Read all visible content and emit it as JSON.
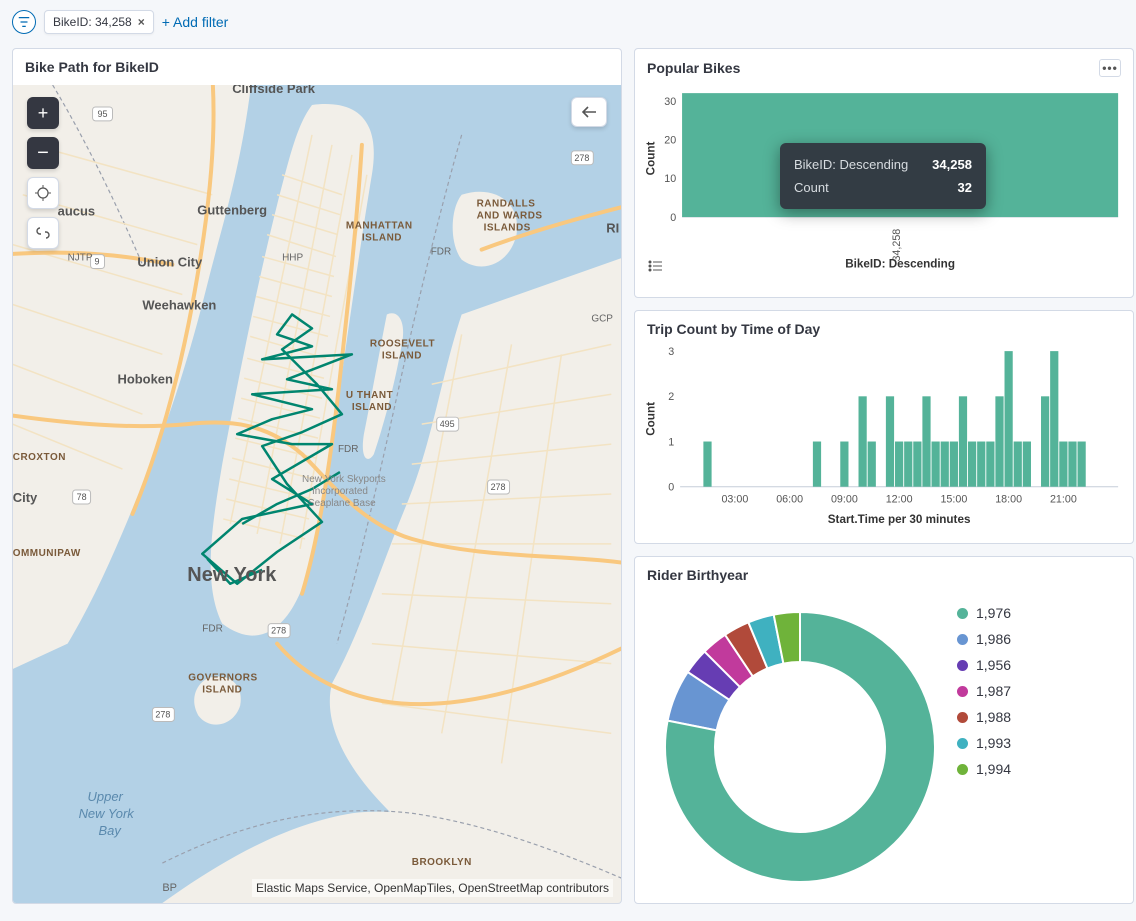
{
  "filter_bar": {
    "filter_pill_label": "BikeID: 34,258",
    "add_filter_label": "+ Add filter"
  },
  "map_panel": {
    "title": "Bike Path for BikeID",
    "attribution": "Elastic Maps Service, OpenMapTiles, OpenStreetMap contributors",
    "places": {
      "cliffside": "Cliffside Park",
      "guttenberg": "Guttenberg",
      "unioncity": "Union City",
      "weehawken": "Weehawken",
      "hoboken": "Hoboken",
      "newyork": "New York",
      "brooklyn": "BROOKLYN",
      "manhattan_is": "MANHATTAN ISLAND",
      "randalls_is": "RANDALLS AND WARDS ISLANDS",
      "roosevelt_is": "ROOSEVELT ISLAND",
      "uthant_is": "U THANT ISLAND",
      "governors_is": "GOVERNORS ISLAND",
      "aucus": "aucus",
      "city": "City",
      "ri": "RI",
      "ommunipaw": "OMMUNIPAW",
      "croxton": "CROXTON",
      "bay": "Upper New York Bay",
      "skyports": "New York Skyports Incorporated Seaplane Base",
      "bp": "BP",
      "njtp": "NJTP",
      "hhp": "HHP",
      "fdr": "FDR",
      "gcp": "GCP"
    },
    "road_badges": [
      "95",
      "278",
      "278",
      "278",
      "495",
      "278",
      "78",
      "9"
    ]
  },
  "popular_panel": {
    "title": "Popular Bikes",
    "y_label": "Count",
    "x_label": "BikeID: Descending",
    "x_tick": "34,258",
    "tooltip": {
      "row1_k": "BikeID: Descending",
      "row1_v": "34,258",
      "row2_k": "Count",
      "row2_v": "32"
    }
  },
  "tod_panel": {
    "title": "Trip Count by Time of Day",
    "y_label": "Count",
    "x_label": "Start.Time per 30 minutes"
  },
  "by_panel": {
    "title": "Rider Birthyear"
  },
  "chart_data": [
    {
      "id": "popular_bikes",
      "type": "bar",
      "orientation": "vertical",
      "categories": [
        "34,258"
      ],
      "values": [
        32
      ],
      "xlabel": "BikeID: Descending",
      "ylabel": "Count",
      "y_ticks": [
        0,
        10,
        20,
        30
      ],
      "ylim": [
        0,
        32
      ]
    },
    {
      "id": "trip_count_time_of_day",
      "type": "bar",
      "categories_hours": [
        "01:30",
        "07:30",
        "09:00",
        "10:00",
        "10:30",
        "11:30",
        "12:00",
        "12:30",
        "13:00",
        "13:30",
        "14:00",
        "14:30",
        "15:00",
        "15:30",
        "16:00",
        "16:30",
        "17:00",
        "17:30",
        "18:00",
        "18:30",
        "19:00",
        "20:00",
        "20:30",
        "21:00",
        "21:30",
        "22:00"
      ],
      "values": [
        1,
        1,
        1,
        2,
        1,
        2,
        1,
        1,
        1,
        2,
        1,
        1,
        1,
        2,
        1,
        1,
        1,
        2,
        3,
        1,
        1,
        2,
        3,
        1,
        1,
        1
      ],
      "xlabel": "Start.Time per 30 minutes",
      "ylabel": "Count",
      "x_ticks": [
        "03:00",
        "06:00",
        "09:00",
        "12:00",
        "15:00",
        "18:00",
        "21:00"
      ],
      "y_ticks": [
        0,
        1,
        2,
        3
      ],
      "ylim": [
        0,
        3
      ]
    },
    {
      "id": "rider_birthyear",
      "type": "pie",
      "subtype": "donut",
      "series": [
        {
          "name": "1,976",
          "value": 25,
          "color": "#54b399"
        },
        {
          "name": "1,986",
          "value": 2,
          "color": "#6895d2"
        },
        {
          "name": "1,956",
          "value": 1,
          "color": "#663db3"
        },
        {
          "name": "1,987",
          "value": 1,
          "color": "#c13a9c"
        },
        {
          "name": "1,988",
          "value": 1,
          "color": "#b14a3a"
        },
        {
          "name": "1,993",
          "value": 1,
          "color": "#3fb1c0"
        },
        {
          "name": "1,994",
          "value": 1,
          "color": "#6fb33a"
        }
      ]
    }
  ]
}
